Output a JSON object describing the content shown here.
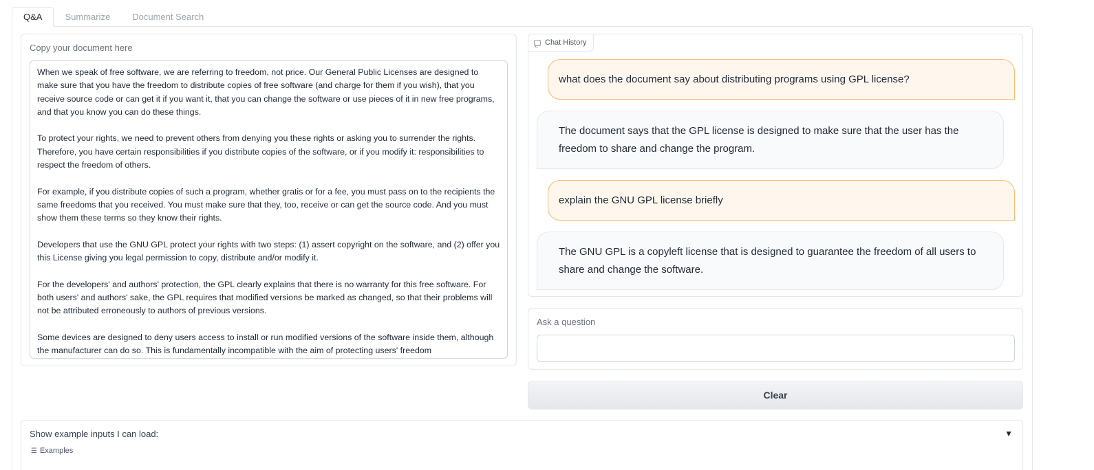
{
  "tabs": [
    {
      "label": "Q&A"
    },
    {
      "label": "Summarize"
    },
    {
      "label": "Document Search"
    }
  ],
  "document": {
    "label": "Copy your document here",
    "paragraphs": [
      "When we speak of free software, we are referring to freedom, not price. Our General Public Licenses are designed to make sure that you have the freedom to distribute copies of free software (and charge for them if you wish), that you receive source code or can get it if you want it, that you can change the software or use pieces of it in new free programs, and that you know you can do these things.",
      "To protect your rights, we need to prevent others from denying you these rights or asking you to surrender the rights. Therefore, you have certain responsibilities if you distribute copies of the software, or if you modify it: responsibilities to respect the freedom of others.",
      "For example, if you distribute copies of such a program, whether gratis or for a fee, you must pass on to the recipients the same freedoms that you received. You must make sure that they, too, receive or can get the source code. And you must show them these terms so they know their rights.",
      "Developers that use the GNU GPL protect your rights with two steps: (1) assert copyright on the software, and (2) offer you this License giving you legal permission to copy, distribute and/or modify it.",
      "For the developers' and authors' protection, the GPL clearly explains that there is no warranty for this free software. For both users' and authors' sake, the GPL requires that modified versions be marked as changed, so that their problems will not be attributed erroneously to authors of previous versions.",
      "Some devices are designed to deny users access to install or run modified versions of the software inside them, although the manufacturer can do so. This is fundamentally incompatible with the aim of protecting users' freedom"
    ]
  },
  "chat": {
    "label": "Chat History",
    "messages": [
      {
        "role": "user",
        "text": "what does the document say about distributing programs using GPL license?"
      },
      {
        "role": "bot",
        "text": "The document says that the GPL license is designed to make sure that the user has the freedom to share and change the program."
      },
      {
        "role": "user",
        "text": "explain the GNU GPL license briefly"
      },
      {
        "role": "bot",
        "text": "The GNU GPL is a copyleft license that is designed to guarantee the freedom of all users to share and change the software."
      }
    ]
  },
  "question": {
    "label": "Ask a question",
    "value": ""
  },
  "clear_label": "Clear",
  "examples": {
    "label": "Show example inputs I can load:",
    "toggle": "▼",
    "sub_label": "Examples"
  },
  "colors": {
    "user_bubble_bg": "#fff7ed",
    "user_bubble_border": "#fdba74",
    "bot_bubble_bg": "#f9fafb"
  }
}
